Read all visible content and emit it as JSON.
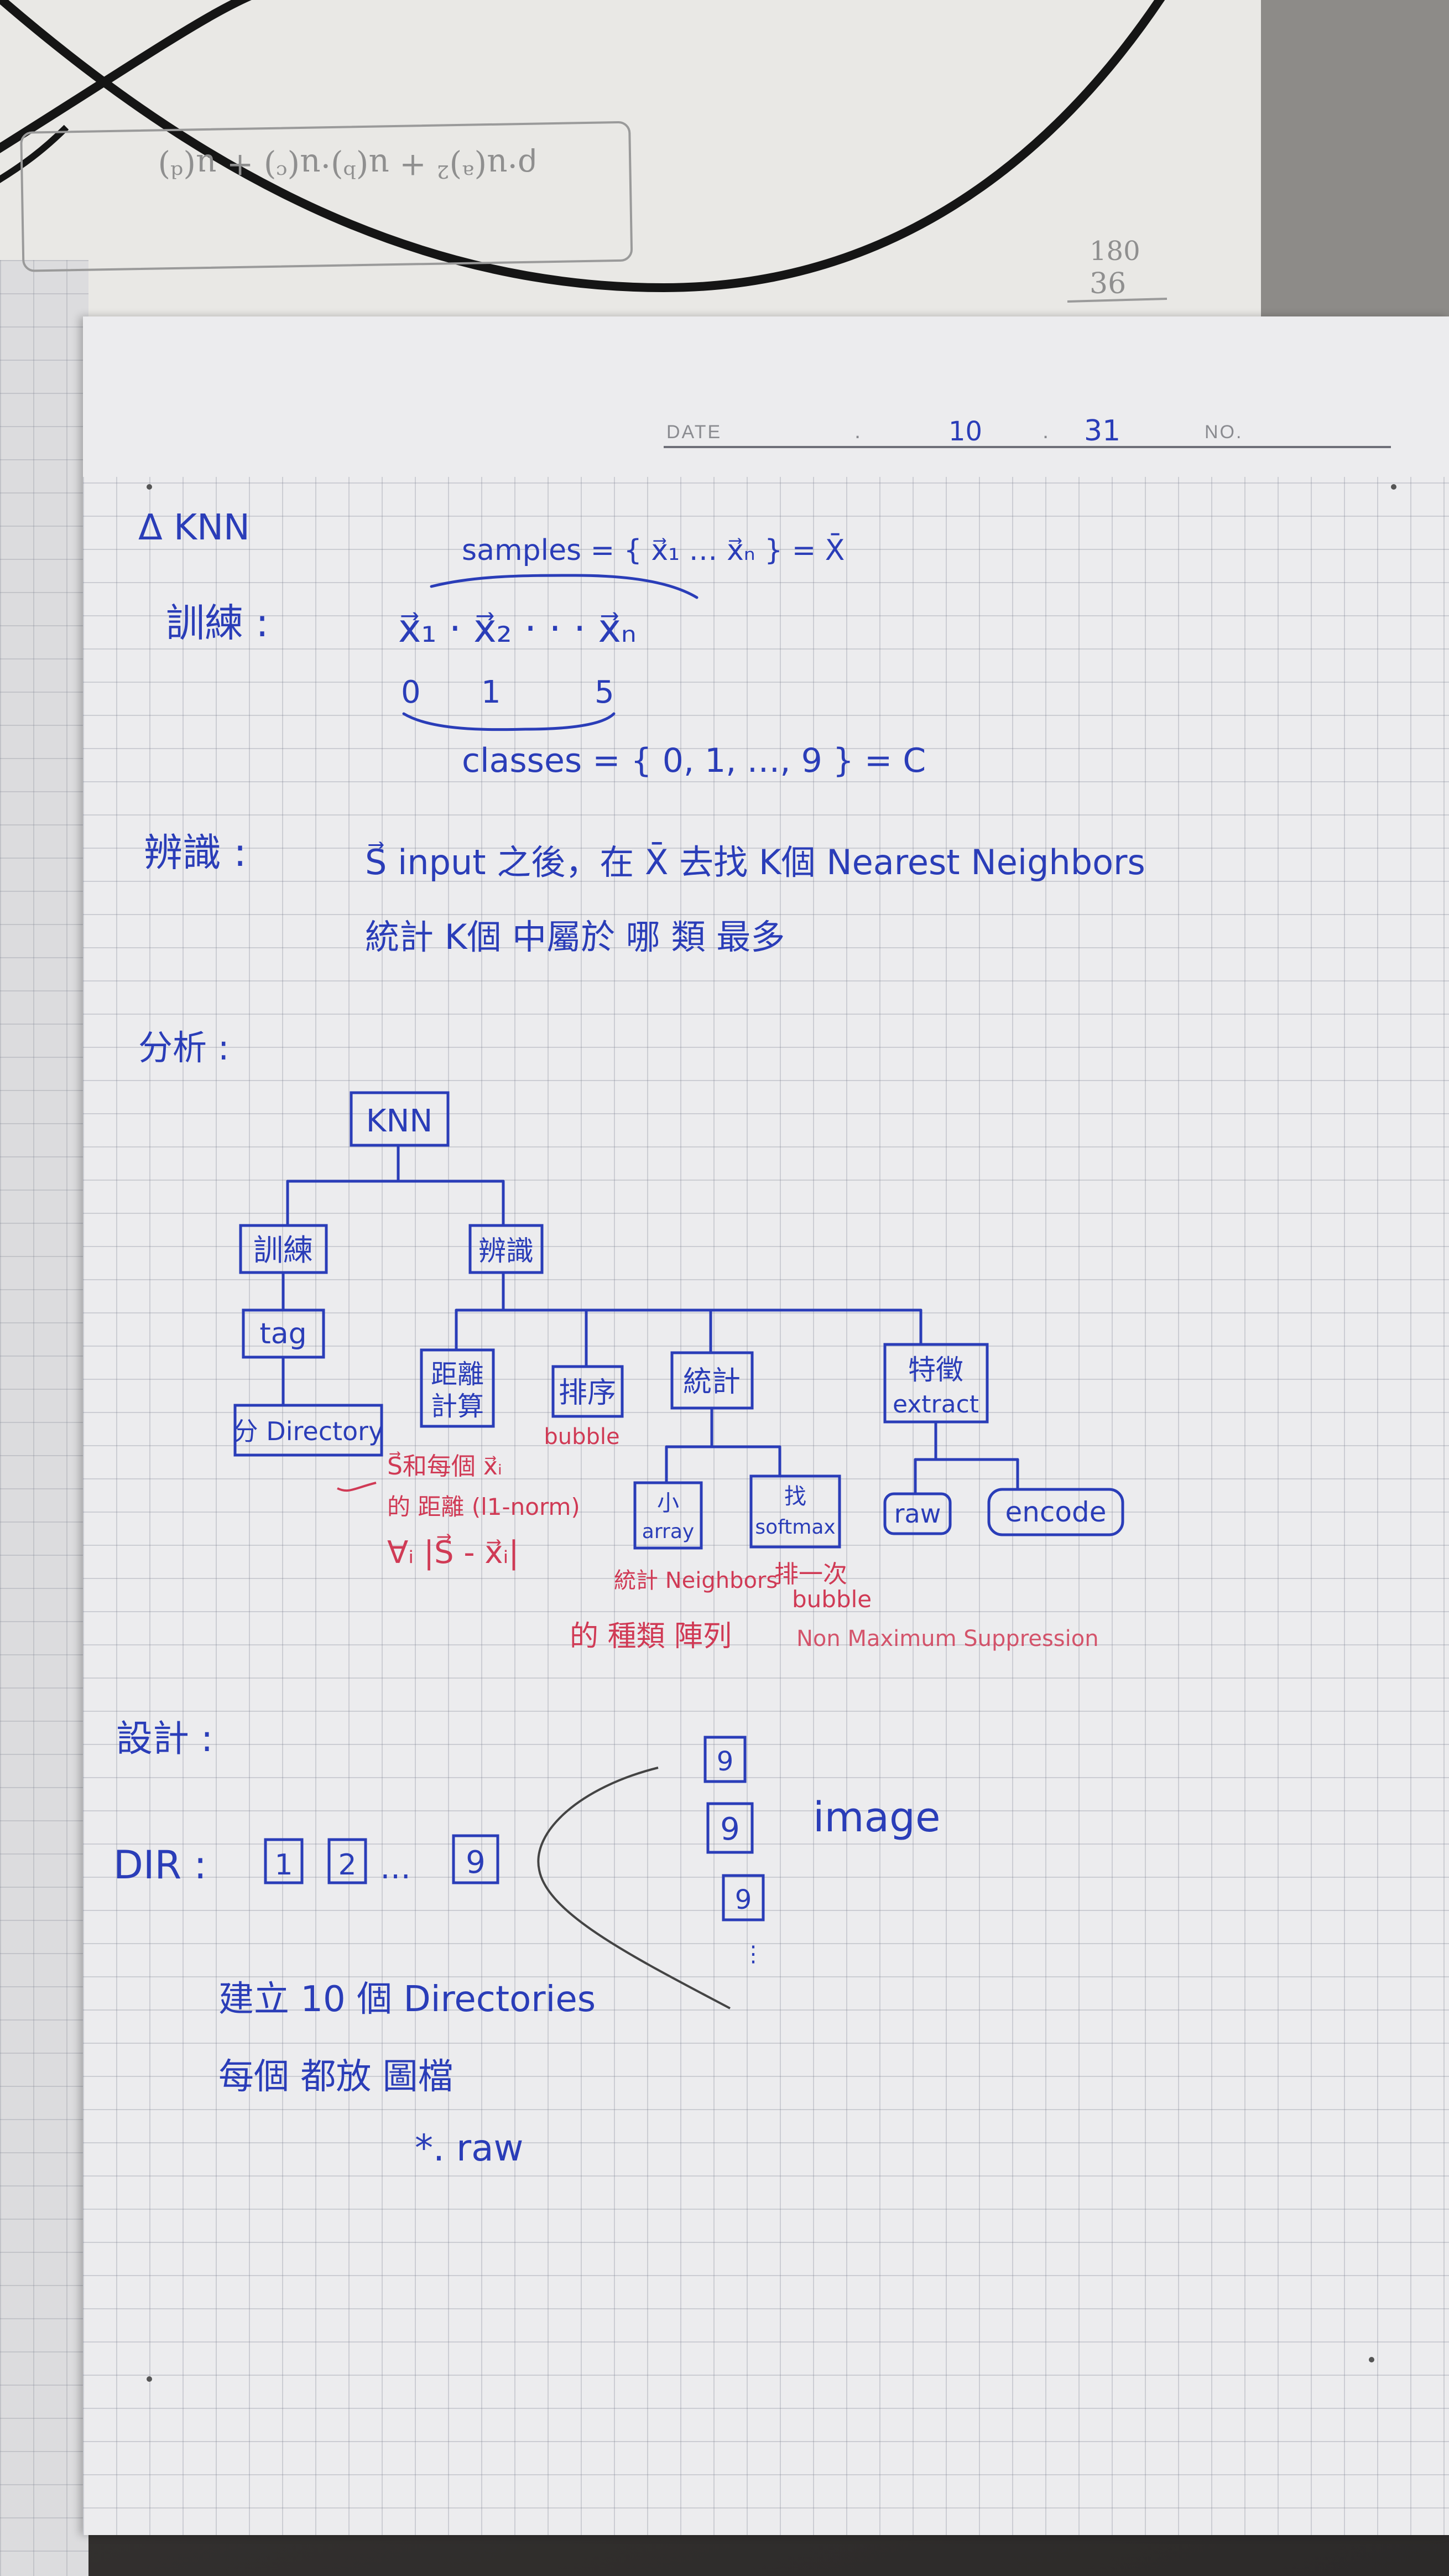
{
  "header": {
    "date_label": "DATE",
    "month": "10",
    "day": "31",
    "no_label": "NO."
  },
  "top_scribble": {
    "line1": "ρ·u(ᵃ)² + u(ᵇ)·u(ᶜ) + u(ᵈ)",
    "num1": "180",
    "num2": "36"
  },
  "title": "Δ KNN",
  "training": {
    "label": "訓練 :",
    "samples": "samples = { x⃗₁ … x⃗ₙ } = X̄",
    "vectors": "x⃗₁ · x⃗₂ · · · x⃗ₙ",
    "l0": "0",
    "l1": "1",
    "l5": "5",
    "classes": "classes = { 0, 1, …, 9 } = C"
  },
  "recognition": {
    "label": "辨識 :",
    "line1": "S⃗  input 之後，在 X̄ 去找 K個 Nearest Neighbors",
    "line2": "統計 K個 中屬於 哪 類 最多"
  },
  "analysis": {
    "label": "分析 :",
    "root": "KNN",
    "train": "訓練",
    "recog": "辨識",
    "tag": "tag",
    "dir": "分 Directory",
    "dist1": "距離",
    "dist2": "計算",
    "sort": "排序",
    "stat": "統計",
    "feat1": "特徵",
    "feat2": "extract",
    "bubble": "bubble",
    "small1": "小",
    "small2": "array",
    "find1": "找",
    "find2": "softmax",
    "raw": "raw",
    "encode": "encode",
    "dist_note1": "S⃗和每個 x⃗ᵢ",
    "dist_note2": "的 距離 (l1-norm)",
    "dist_note3": "∀ᵢ |S⃗ - x⃗ᵢ|",
    "stat_note1": "統計 Neighbors",
    "stat_note2": "的 種類 陣列",
    "find_note1": "排一次",
    "find_note2": "bubble",
    "find_note3": "Non Maximum Suppression"
  },
  "design": {
    "label": "設計 :",
    "dir_label": "DIR :",
    "d1": "1",
    "d2": "2",
    "dots": "…",
    "d9": "9",
    "f1": "9",
    "f2": "9",
    "f3": "9",
    "vdots": "⋮",
    "image": "image",
    "note1": "建立 10 個 Directories",
    "note2": "每個 都放 圖檔",
    "note3": "*. raw"
  }
}
